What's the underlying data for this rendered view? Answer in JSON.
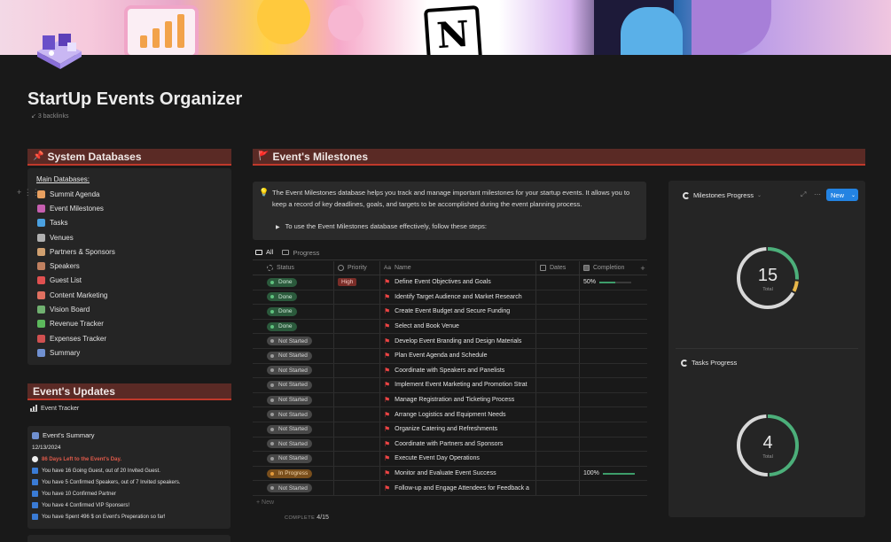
{
  "page": {
    "title": "StartUp Events Organizer",
    "backlinks": "3 backlinks"
  },
  "system_db": {
    "heading": "System Databases",
    "main_label": "Main Databases:",
    "items": [
      {
        "label": "Summit Agenda",
        "icon": "rocket-icon",
        "color": "#e8a060"
      },
      {
        "label": "Event Milestones",
        "icon": "milestone-icon",
        "color": "#c65fb0"
      },
      {
        "label": "Tasks",
        "icon": "gear-icon",
        "color": "#4aa0e0"
      },
      {
        "label": "Venues",
        "icon": "building-icon",
        "color": "#b0b0b0"
      },
      {
        "label": "Partners & Sponsors",
        "icon": "handshake-icon",
        "color": "#d0a070"
      },
      {
        "label": "Speakers",
        "icon": "people-icon",
        "color": "#c08060"
      },
      {
        "label": "Guest List",
        "icon": "guest-icon",
        "color": "#e05050"
      },
      {
        "label": "Content Marketing",
        "icon": "megaphone-icon",
        "color": "#e07060"
      },
      {
        "label": "Vision Board",
        "icon": "vision-icon",
        "color": "#70b070"
      },
      {
        "label": "Revenue Tracker",
        "icon": "money-icon",
        "color": "#5cb85c"
      },
      {
        "label": "Expenses Tracker",
        "icon": "expenses-icon",
        "color": "#d05050"
      },
      {
        "label": "Summary",
        "icon": "summary-icon",
        "color": "#7090d0"
      }
    ]
  },
  "updates": {
    "heading": "Event's Updates",
    "tracker_label": "Event Tracker",
    "summary": {
      "title": "Event's Summary",
      "date": "12/13/2024",
      "countdown": "86 Days Left to the Event's Day.",
      "lines": [
        "You have 16 Going Guest, out of 20 Invited Guest.",
        "You have 5 Confirmed Speakers, out of 7 Invited speakers.",
        "You have 10 Confirmed Partner",
        "You have 4 Confirmed VIP Sponsers!",
        "You have Spent 496 $ on Event's Preperation so far!"
      ]
    }
  },
  "milestones": {
    "heading": "Event's Milestones",
    "callout_text": "The Event Milestones database helps you track and manage important milestones for your startup events. It allows you to keep a record of key deadlines, goals, and targets to be accomplished during the event planning process.",
    "toggle_text": "To use the Event Milestones database effectively, follow these steps:",
    "tabs": [
      "All",
      "Progress"
    ],
    "columns": {
      "status": "Status",
      "priority": "Priority",
      "name": "Name",
      "dates": "Dates",
      "completion": "Completion"
    },
    "rows": [
      {
        "status": "Done",
        "priority": "High",
        "name": "Define Event Objectives and Goals",
        "completion": "50%",
        "progress": 0.5
      },
      {
        "status": "Done",
        "priority": "",
        "name": "Identify Target Audience and Market Research",
        "completion": "",
        "progress": null
      },
      {
        "status": "Done",
        "priority": "",
        "name": "Create Event Budget and Secure Funding",
        "completion": "",
        "progress": null
      },
      {
        "status": "Done",
        "priority": "",
        "name": "Select and Book Venue",
        "completion": "",
        "progress": null
      },
      {
        "status": "Not Started",
        "priority": "",
        "name": "Develop Event Branding and Design Materials",
        "completion": "",
        "progress": null
      },
      {
        "status": "Not Started",
        "priority": "",
        "name": "Plan Event Agenda and Schedule",
        "completion": "",
        "progress": null
      },
      {
        "status": "Not Started",
        "priority": "",
        "name": "Coordinate with Speakers and Panelists",
        "completion": "",
        "progress": null
      },
      {
        "status": "Not Started",
        "priority": "",
        "name": "Implement Event Marketing and Promotion Strat",
        "completion": "",
        "progress": null
      },
      {
        "status": "Not Started",
        "priority": "",
        "name": "Manage Registration and Ticketing Process",
        "completion": "",
        "progress": null
      },
      {
        "status": "Not Started",
        "priority": "",
        "name": "Arrange Logistics and Equipment Needs",
        "completion": "",
        "progress": null
      },
      {
        "status": "Not Started",
        "priority": "",
        "name": "Organize Catering and Refreshments",
        "completion": "",
        "progress": null
      },
      {
        "status": "Not Started",
        "priority": "",
        "name": "Coordinate with Partners and Sponsors",
        "completion": "",
        "progress": null
      },
      {
        "status": "Not Started",
        "priority": "",
        "name": "Execute Event Day Operations",
        "completion": "",
        "progress": null
      },
      {
        "status": "In Progress",
        "priority": "",
        "name": "Monitor and Evaluate Event Success",
        "completion": "100%",
        "progress": 1.0
      },
      {
        "status": "Not Started",
        "priority": "",
        "name": "Follow-up and Engage Attendees for Feedback a",
        "completion": "",
        "progress": null
      }
    ],
    "new_label": "New",
    "complete_label": "COMPLETE",
    "complete_value": "4/15"
  },
  "charts": {
    "new_button": "New",
    "milestones": {
      "title": "Milestones Progress",
      "total": "15",
      "label": "Total",
      "segments": [
        {
          "status": "Done",
          "count": 4,
          "color": "#4caf7a"
        },
        {
          "status": "In Progress",
          "count": 1,
          "color": "#e8b84a"
        },
        {
          "status": "Not Started",
          "count": 10,
          "color": "#d8d8d8"
        }
      ]
    },
    "tasks": {
      "title": "Tasks Progress",
      "total": "4",
      "label": "Total",
      "segments": [
        {
          "status": "Done",
          "count": 2,
          "color": "#4caf7a"
        },
        {
          "status": "Not Started",
          "count": 2,
          "color": "#d8d8d8"
        }
      ]
    }
  }
}
